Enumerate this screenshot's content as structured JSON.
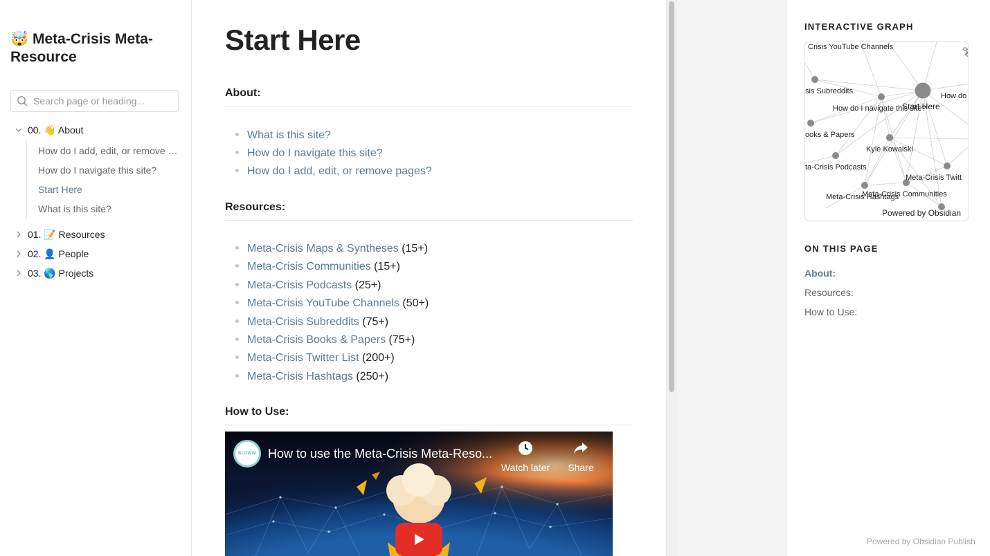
{
  "site": {
    "emoji": "🤯",
    "title": "Meta-Crisis Meta-Resource"
  },
  "search": {
    "placeholder": "Search page or heading..."
  },
  "nav": {
    "folders": [
      {
        "label": "00. 👋 About"
      },
      {
        "label": "01. 📝 Resources"
      },
      {
        "label": "02. 👤 People"
      },
      {
        "label": "03. 🌎 Projects"
      }
    ],
    "about_children": [
      {
        "label": "How do I add, edit, or remove pages?"
      },
      {
        "label": "How do I navigate this site?"
      },
      {
        "label": "Start Here"
      },
      {
        "label": "What is this site?"
      }
    ]
  },
  "page": {
    "title": "Start Here",
    "about": {
      "heading": "About:",
      "links": [
        {
          "text": "What is this site?"
        },
        {
          "text": "How do I navigate this site?"
        },
        {
          "text": "How do I add, edit, or remove pages?"
        }
      ]
    },
    "resources": {
      "heading": "Resources:",
      "items": [
        {
          "text": "Meta-Crisis Maps & Syntheses",
          "count": "(15+)"
        },
        {
          "text": "Meta-Crisis Communities",
          "count": "(15+)"
        },
        {
          "text": "Meta-Crisis Podcasts",
          "count": "(25+)"
        },
        {
          "text": "Meta-Crisis YouTube Channels",
          "count": "(50+)"
        },
        {
          "text": "Meta-Crisis Subreddits",
          "count": "(75+)"
        },
        {
          "text": "Meta-Crisis Books & Papers",
          "count": "(75+)"
        },
        {
          "text": "Meta-Crisis Twitter List",
          "count": "(200+)"
        },
        {
          "text": "Meta-Crisis Hashtags",
          "count": "(250+)"
        }
      ]
    },
    "how_to_use": {
      "heading": "How to Use:"
    },
    "video": {
      "channel_badge": "BLOWW",
      "title": "How to use the Meta-Crisis Meta-Reso...",
      "watch_later": "Watch later",
      "share": "Share"
    }
  },
  "right": {
    "graph_heading": "INTERACTIVE GRAPH",
    "graph_labels": {
      "youtube": "Crisis YouTube Channels",
      "subreddits": "sis Subreddits",
      "howdo": "How do",
      "navigate": "How do I navigate this site?",
      "start_here": "Start Here",
      "books": "ooks & Papers",
      "kyle": "Kyle Kowalski",
      "podcasts": "ta-Crisis Podcasts",
      "twitter": "Meta-Crisis Twitt",
      "communities": "Meta-Crisis Communities",
      "hashtags": "Meta-Crisis Hashtags",
      "powered": "Powered by Obsidian"
    },
    "toc_heading": "ON THIS PAGE",
    "toc": [
      {
        "label": "About:"
      },
      {
        "label": "Resources:"
      },
      {
        "label": "How to Use:"
      }
    ],
    "footer": "Powered by Obsidian Publish"
  }
}
